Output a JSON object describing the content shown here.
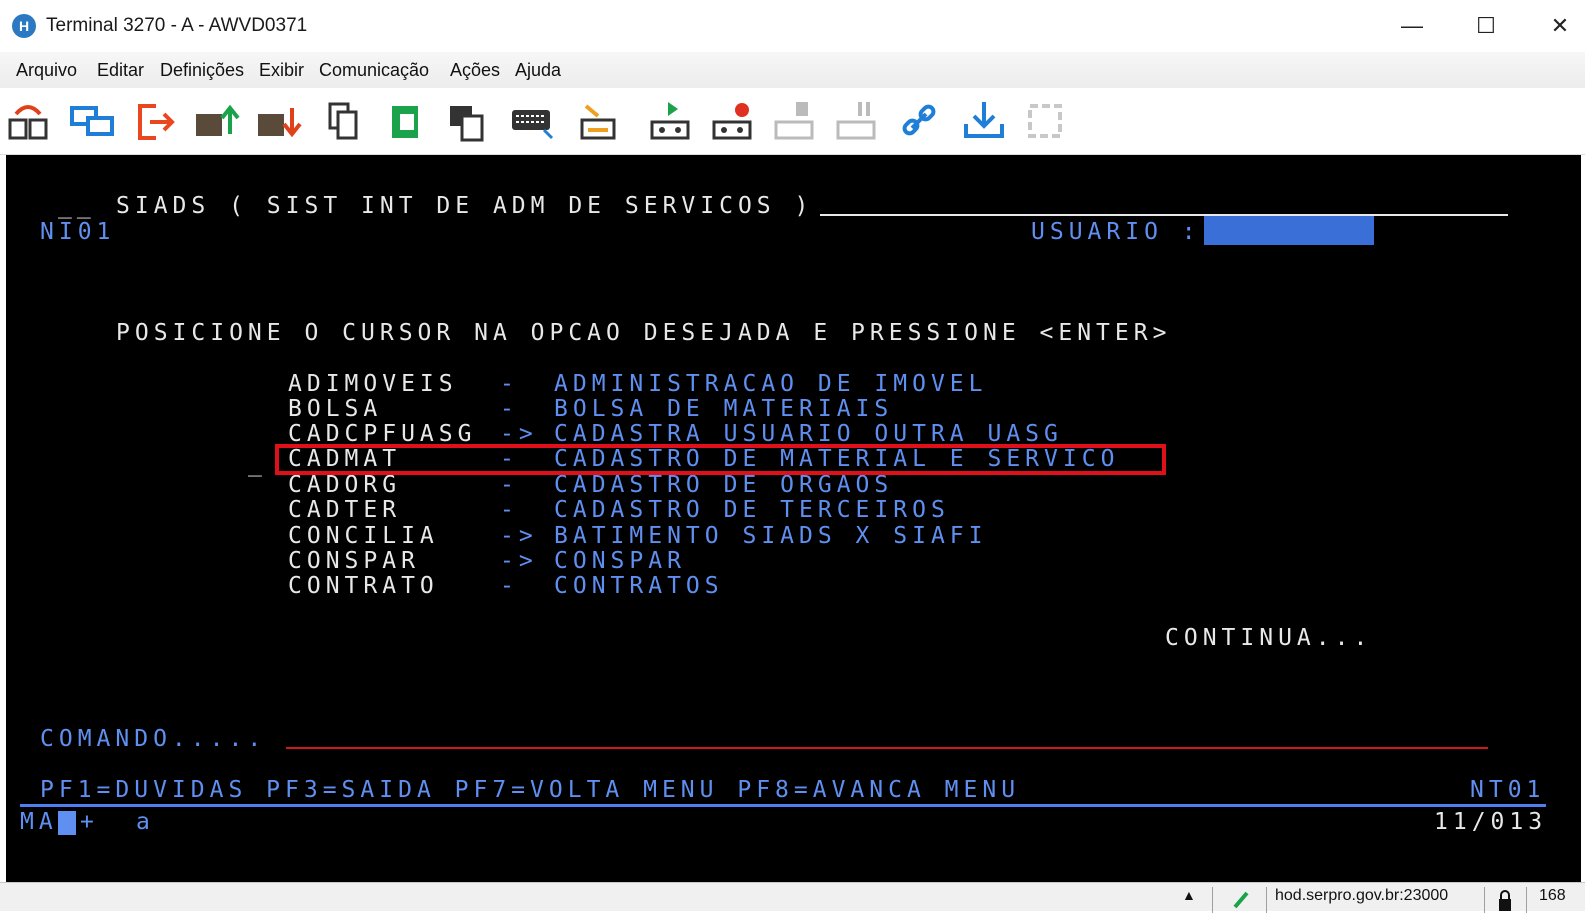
{
  "window": {
    "app_icon": "H",
    "title": "Terminal 3270 - A - AWVD0371",
    "minimize": "—",
    "maximize": "☐",
    "close": "✕"
  },
  "menu": [
    "Arquivo",
    "Editar",
    "Definições",
    "Exibir",
    "Comunicação",
    "Ações",
    "Ajuda"
  ],
  "toolbar_icons": [
    "disconnect-icon",
    "switch-session-icon",
    "exit-icon",
    "send-file-icon",
    "receive-file-icon",
    "copy-icon",
    "paste-icon",
    "paste-next-icon",
    "keypad-icon",
    "print-screen-icon",
    "play-macro-icon",
    "record-macro-icon",
    "stop-macro-icon",
    "pause-macro-icon",
    "link-icon",
    "download-icon",
    "refresh-icon"
  ],
  "terminal": {
    "header_prefix": "__",
    "system_title": "SIADS ( SIST INT DE ADM DE SERVICOS )",
    "screen_id": "NI01",
    "user_label": "USUARIO :",
    "user_value": "",
    "instruction": "POSICIONE O CURSOR NA OPCAO DESEJADA E PRESSIONE <ENTER>",
    "options": [
      {
        "code": "ADIMOVEIS",
        "sep": "-",
        "desc": "ADMINISTRACAO DE IMOVEL"
      },
      {
        "code": "BOLSA",
        "sep": "-",
        "desc": "BOLSA DE MATERIAIS"
      },
      {
        "code": "CADCPFUASG",
        "sep": "->",
        "desc": "CADASTRA USUARIO OUTRA UASG"
      },
      {
        "code": "CADMAT",
        "sep": "-",
        "desc": "CADASTRO DE MATERIAL E SERVICO"
      },
      {
        "code": "CADORG",
        "sep": "-",
        "desc": "CADASTRO DE ORGAOS"
      },
      {
        "code": "CADTER",
        "sep": "-",
        "desc": "CADASTRO DE TERCEIROS"
      },
      {
        "code": "CONCILIA",
        "sep": "->",
        "desc": "BATIMENTO SIADS X SIAFI"
      },
      {
        "code": "CONSPAR",
        "sep": "->",
        "desc": "CONSPAR"
      },
      {
        "code": "CONTRATO",
        "sep": "-",
        "desc": "CONTRATOS"
      }
    ],
    "selected_option_index": 3,
    "cursor_marker": "_",
    "continua": "CONTINUA...",
    "command_label": "COMANDO.....",
    "command_value": "",
    "pf_keys": "PF1=DUVIDAS PF3=SAIDA PF7=VOLTA MENU PF8=AVANCA MENU",
    "terminal_id": "NT01",
    "oia_left": "MA",
    "oia_plus": "+",
    "oia_a": "a",
    "cursor_pos": "11/013"
  },
  "statusbar": {
    "host": "hod.serpro.gov.br:23000",
    "extra": "168"
  },
  "colors": {
    "terminal_bg": "#000000",
    "text_white": "#e8e8e8",
    "text_blue": "#5f8ff0",
    "highlight_red": "#e0101a"
  }
}
